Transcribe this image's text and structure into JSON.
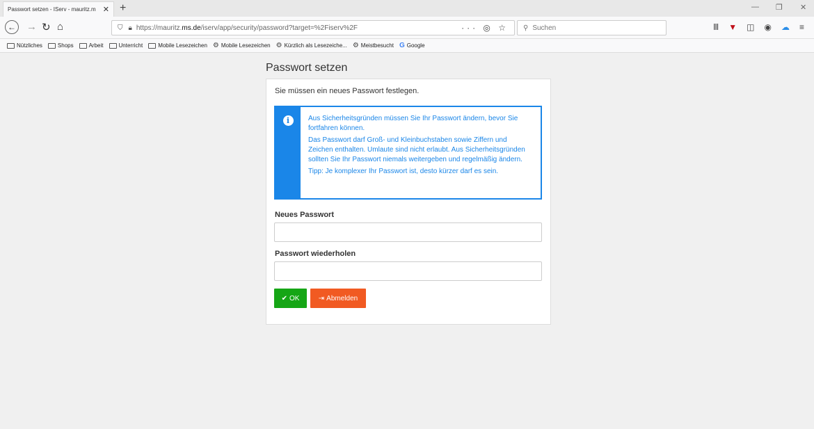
{
  "browser": {
    "tab_title": "Passwort setzen - IServ - mauritz.m",
    "tab_close": "✕",
    "new_tab": "+",
    "url_host": "https://mauritz.",
    "url_domain": "ms.de",
    "url_path": "/iserv/app/security/password?target=%2Fiserv%2F",
    "url_actions": "··· ◎ ☆",
    "search_placeholder": "Suchen",
    "window_minimize": "—",
    "window_restore": "❐",
    "window_close": "✕"
  },
  "bookmarks": [
    {
      "label": "Nützliches",
      "icon": "folder-icon"
    },
    {
      "label": "Shops",
      "icon": "folder-icon"
    },
    {
      "label": "Arbeit",
      "icon": "folder-icon"
    },
    {
      "label": "Unterricht",
      "icon": "folder-icon"
    },
    {
      "label": "Mobile Lesezeichen",
      "icon": "folder-icon"
    },
    {
      "label": "Mobile Lesezeichen",
      "icon": "gear-icon"
    },
    {
      "label": "Kürzlich als Lesezeiche...",
      "icon": "gear-icon"
    },
    {
      "label": "Meistbesucht",
      "icon": "gear-icon"
    },
    {
      "label": "Google",
      "icon": "google-icon"
    }
  ],
  "page": {
    "title": "Passwort setzen",
    "lead": "Sie müssen ein neues Passwort festlegen.",
    "alert": {
      "p1": "Aus Sicherheitsgründen müssen Sie Ihr Passwort ändern, bevor Sie fortfahren können.",
      "p2": "Das Passwort darf Groß- und Kleinbuchstaben sowie Ziffern und Zeichen enthalten. Umlaute sind nicht erlaubt. Aus Sicherheitsgründen sollten Sie Ihr Passwort niemals weitergeben und regelmäßig ändern.",
      "p3": "Tipp: Je komplexer Ihr Passwort ist, desto kürzer darf es sein."
    },
    "new_password_label": "Neues Passwort",
    "new_password_value": "",
    "repeat_password_label": "Passwort wiederholen",
    "repeat_password_value": "",
    "ok_label": "OK",
    "logout_label": "Abmelden"
  },
  "colors": {
    "info": "#1a86e8",
    "ok": "#16a616",
    "logout": "#f15a22"
  }
}
